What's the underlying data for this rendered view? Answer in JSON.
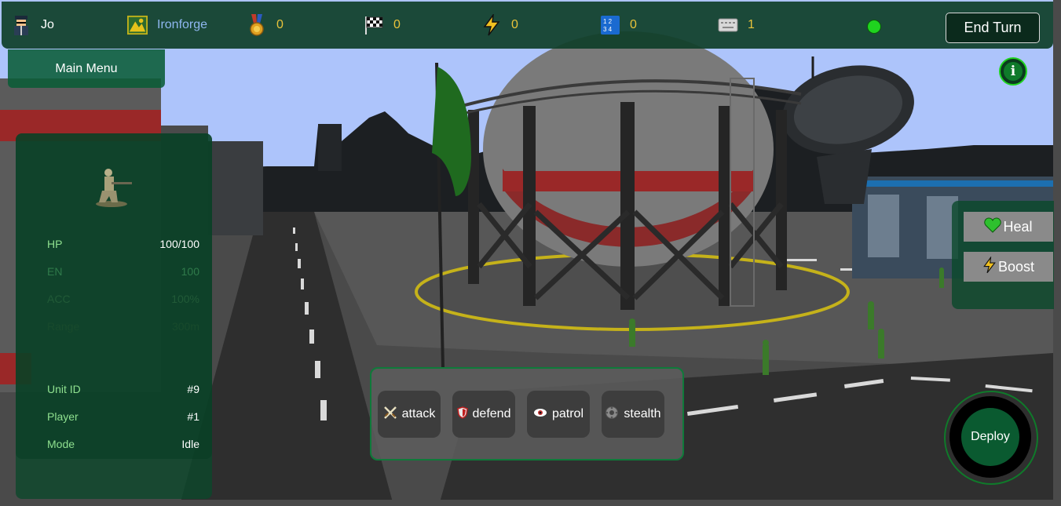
{
  "topbar": {
    "player_name": "Jo",
    "city_name": "Ironforge",
    "medals": "0",
    "flags": "0",
    "energy": "0",
    "tiles": "0",
    "cards": "1",
    "end_turn_label": "End Turn"
  },
  "main_menu_label": "Main Menu",
  "unit": {
    "stats": [
      {
        "key": "HP",
        "value": "100/100"
      },
      {
        "key": "EN",
        "value": "100"
      },
      {
        "key": "ACC",
        "value": "100%"
      },
      {
        "key": "Range",
        "value": "300m"
      }
    ],
    "info": [
      {
        "key": "Unit ID",
        "value": "#9"
      },
      {
        "key": "Player",
        "value": "#1"
      },
      {
        "key": "Mode",
        "value": "Idle"
      }
    ]
  },
  "side_buttons": {
    "heal": "Heal",
    "boost": "Boost"
  },
  "actions": [
    {
      "label": "attack",
      "icon": "crossed-swords-icon"
    },
    {
      "label": "defend",
      "icon": "shield-icon"
    },
    {
      "label": "patrol",
      "icon": "eye-icon"
    },
    {
      "label": "stealth",
      "icon": "gear-icon"
    }
  ],
  "deploy_label": "Deploy",
  "colors": {
    "panel_green": "#0a5c37",
    "accent_green": "#1fd31f",
    "value_gold": "#e9c33a",
    "sky": "#aec6ff"
  }
}
